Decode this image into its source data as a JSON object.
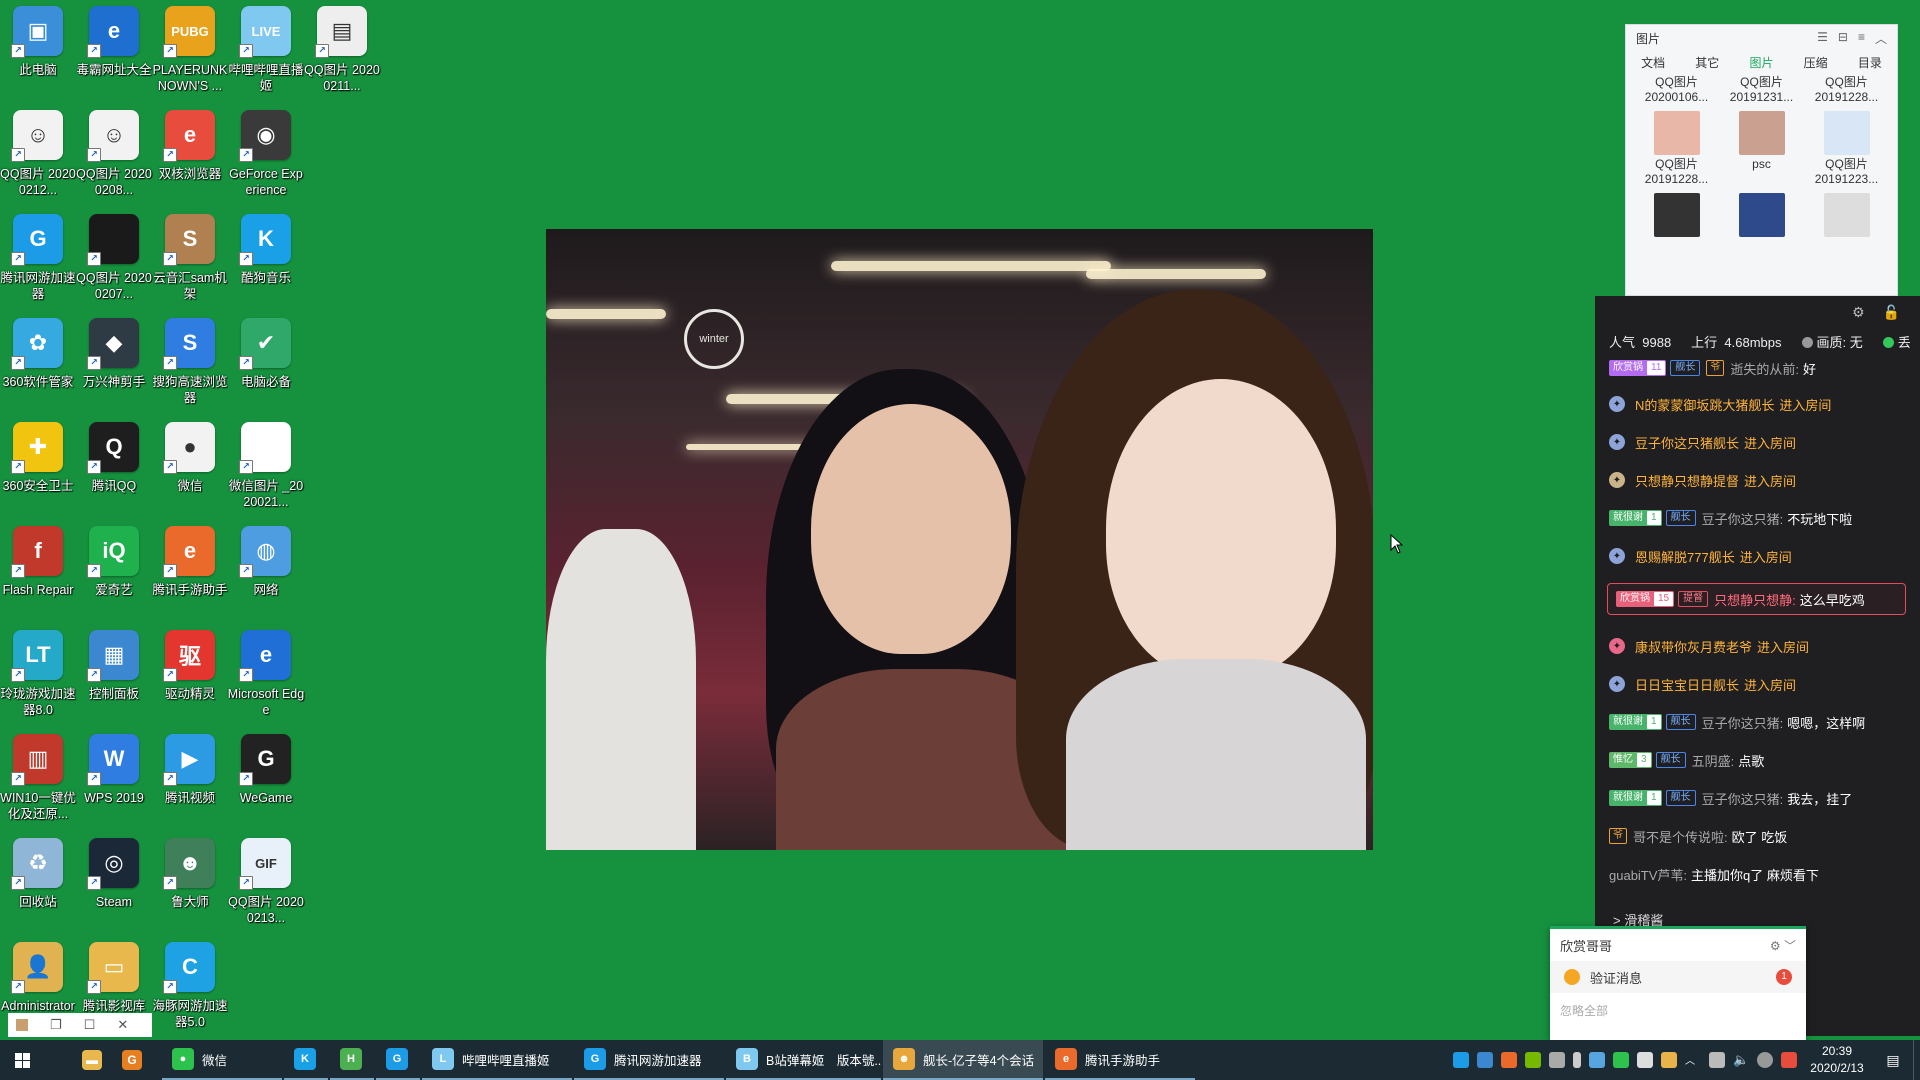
{
  "desktop": {
    "icons": [
      {
        "label": "此电脑",
        "bg": "#3a8fd8",
        "glyph": "▣",
        "icon": "computer-icon"
      },
      {
        "label": "毒霸网址大全",
        "bg": "#1e6fd0",
        "glyph": "e",
        "icon": "ie-browser-icon"
      },
      {
        "label": "PLAYERUNKNOWN'S ...",
        "bg": "#e8a21c",
        "glyph": "PUBG",
        "icon": "pubg-icon"
      },
      {
        "label": "哔哩哔哩直播姬",
        "bg": "#7fc8f0",
        "glyph": "LIVE",
        "icon": "bilibili-live-icon"
      },
      {
        "label": "QQ图片 20200211...",
        "bg": "#eeeeee",
        "glyph": "▤",
        "icon": "image-file-icon"
      },
      {
        "label": "QQ图片 20200212...",
        "bg": "#f2f2f2",
        "glyph": "☺",
        "icon": "image-file-icon"
      },
      {
        "label": "QQ图片 20200208...",
        "bg": "#f2f2f2",
        "glyph": "☺",
        "icon": "image-file-icon"
      },
      {
        "label": "双核浏览器",
        "bg": "#e84c3d",
        "glyph": "e",
        "icon": "dual-core-browser-icon"
      },
      {
        "label": "GeForce Experience",
        "bg": "#3a3a3a",
        "glyph": "◉",
        "icon": "nvidia-icon"
      },
      {
        "label": "腾讯网游加速器",
        "bg": "#1c9be6",
        "glyph": "G",
        "icon": "tencent-accelerator-icon"
      },
      {
        "label": "QQ图片 20200207...",
        "bg": "#1a1a1a",
        "glyph": "",
        "icon": "image-file-icon"
      },
      {
        "label": "云音汇sam机架",
        "bg": "#b08050",
        "glyph": "S",
        "icon": "sam-rack-icon"
      },
      {
        "label": "酷狗音乐",
        "bg": "#1aa0e6",
        "glyph": "K",
        "icon": "kugou-music-icon"
      },
      {
        "label": "360软件管家",
        "bg": "#35a9e0",
        "glyph": "✿",
        "icon": "360-software-icon"
      },
      {
        "label": "万兴神剪手",
        "bg": "#2e3b44",
        "glyph": "◆",
        "icon": "filmora-icon"
      },
      {
        "label": "搜狗高速浏览器",
        "bg": "#2f7de1",
        "glyph": "S",
        "icon": "sogou-browser-icon"
      },
      {
        "label": "电脑必备",
        "bg": "#30a86a",
        "glyph": "✔",
        "icon": "pc-essentials-icon"
      },
      {
        "label": "360安全卫士",
        "bg": "#f1c40f",
        "glyph": "✚",
        "icon": "360-security-icon"
      },
      {
        "label": "腾讯QQ",
        "bg": "#1e1e1e",
        "glyph": "Q",
        "icon": "qq-icon"
      },
      {
        "label": "微信",
        "bg": "#f2f2f2",
        "glyph": "●",
        "icon": "wechat-icon"
      },
      {
        "label": "微信图片 _2020021...",
        "bg": "#ffffff",
        "glyph": "",
        "icon": "image-file-icon"
      },
      {
        "label": "Flash Repair",
        "bg": "#c0392b",
        "glyph": "f",
        "icon": "flash-repair-icon"
      },
      {
        "label": "爱奇艺",
        "bg": "#1fb14d",
        "glyph": "iQ",
        "icon": "iqiyi-icon"
      },
      {
        "label": "腾讯手游助手",
        "bg": "#e96a2a",
        "glyph": "e",
        "icon": "tencent-mobile-game-icon"
      },
      {
        "label": "网络",
        "bg": "#4e9de0",
        "glyph": "◍",
        "icon": "network-icon"
      },
      {
        "label": "玲珑游戏加速器8.0",
        "bg": "#25a9c9",
        "glyph": "LT",
        "icon": "linglong-accelerator-icon"
      },
      {
        "label": "控制面板",
        "bg": "#3c88d0",
        "glyph": "▦",
        "icon": "control-panel-icon"
      },
      {
        "label": "驱动精灵",
        "bg": "#e2362e",
        "glyph": "驱",
        "icon": "driver-genius-icon"
      },
      {
        "label": "Microsoft Edge",
        "bg": "#1f6fd6",
        "glyph": "e",
        "icon": "edge-icon"
      },
      {
        "label": "WIN10一键优化及还原...",
        "bg": "#c0392b",
        "glyph": "▥",
        "icon": "win10-optimizer-icon"
      },
      {
        "label": "WPS 2019",
        "bg": "#2f7de1",
        "glyph": "W",
        "icon": "wps-icon"
      },
      {
        "label": "腾讯视频",
        "bg": "#2d9be4",
        "glyph": "▶",
        "icon": "tencent-video-icon"
      },
      {
        "label": "WeGame",
        "bg": "#222222",
        "glyph": "G",
        "icon": "wegame-icon"
      },
      {
        "label": "回收站",
        "bg": "#8fb6d6",
        "glyph": "♻",
        "icon": "recycle-bin-icon"
      },
      {
        "label": "Steam",
        "bg": "#1b2838",
        "glyph": "◎",
        "icon": "steam-icon"
      },
      {
        "label": "鲁大师",
        "bg": "#3f7f5a",
        "glyph": "☻",
        "icon": "ludashi-icon"
      },
      {
        "label": "QQ图片 20200213...",
        "bg": "#e8f0fa",
        "glyph": "GIF",
        "icon": "gif-file-icon"
      },
      {
        "label": "Administrator",
        "bg": "#e0b250",
        "glyph": "👤",
        "icon": "user-folder-icon"
      },
      {
        "label": "腾讯影视库",
        "bg": "#e9b84c",
        "glyph": "▭",
        "icon": "tencent-film-library-icon"
      },
      {
        "label": "海豚网游加速器5.0",
        "bg": "#1ea2e3",
        "glyph": "C",
        "icon": "dolphin-accelerator-icon"
      }
    ]
  },
  "file_panel": {
    "title": "图片",
    "tabs": [
      "文档",
      "其它",
      "图片",
      "压缩",
      "目录"
    ],
    "active_tab": 2,
    "items": [
      {
        "name": "QQ图片 20200106...",
        "thumb": "none"
      },
      {
        "name": "QQ图片 20191231...",
        "thumb": "none"
      },
      {
        "name": "QQ图片 20191228...",
        "thumb": "none"
      },
      {
        "name": "QQ图片 20191228...",
        "thumb": "#e8b7a8"
      },
      {
        "name": "psc",
        "thumb": "#caa090"
      },
      {
        "name": "QQ图片 20191223...",
        "thumb": "#d9e6f5"
      },
      {
        "name": "",
        "thumb": "#333333"
      },
      {
        "name": "",
        "thumb": "#2f4a8a"
      },
      {
        "name": "",
        "thumb": "#dddddd"
      }
    ]
  },
  "live_panel": {
    "popularity_label": "人气",
    "popularity_value": "9988",
    "upload_label": "上行",
    "upload_value": "4.68mbps",
    "video_label": "画质: 无",
    "audio_label": "丢",
    "messages": [
      {
        "type": "chat",
        "badge": "欣赏锅",
        "badge_color": "#b36cf0",
        "level": "11",
        "role": "舰长",
        "role2": "爷",
        "name": "逝失的从前:",
        "text": "好"
      },
      {
        "type": "enter",
        "icon_color": "#8ea4d8",
        "name": "N的蒙蒙御坂跳大猪舰长",
        "text": "进入房间"
      },
      {
        "type": "enter",
        "icon_color": "#8ea4d8",
        "name": "豆子你这只猪舰长",
        "text": "进入房间"
      },
      {
        "type": "enter",
        "icon_color": "#c9b48a",
        "name": "只想静只想静提督",
        "text": "进入房间"
      },
      {
        "type": "chat",
        "badge": "就很谢",
        "badge_color": "#47b36b",
        "level": "1",
        "role": "舰长",
        "name": "豆子你这只猪:",
        "text": "不玩地下啦"
      },
      {
        "type": "enter",
        "icon_color": "#8ea4d8",
        "name": "恩赐解脱777舰长",
        "text": "进入房间"
      },
      {
        "type": "highlight",
        "badge": "欣赏锅",
        "badge_color": "#e8607a",
        "level": "15",
        "role": "提督",
        "name": "只想静只想静:",
        "text": "这么早吃鸡"
      },
      {
        "type": "enter",
        "icon_color": "#e9688a",
        "name": "康叔带你灰月费老爷",
        "text": "进入房间"
      },
      {
        "type": "enter",
        "icon_color": "#8ea4d8",
        "name": "日日宝宝日日舰长",
        "text": "进入房间"
      },
      {
        "type": "chat",
        "badge": "就很谢",
        "badge_color": "#47b36b",
        "level": "1",
        "role": "舰长",
        "name": "豆子你这只猪:",
        "text": "嗯嗯，这样啊"
      },
      {
        "type": "chat",
        "badge": "惟忆",
        "badge_color": "#5fb86a",
        "level": "3",
        "role": "舰长",
        "name": "五阴盛:",
        "text": "点歌"
      },
      {
        "type": "chat",
        "badge": "就很谢",
        "badge_color": "#47b36b",
        "level": "1",
        "role": "舰长",
        "name": "豆子你这只猪:",
        "text": "我去，挂了"
      },
      {
        "type": "chat",
        "role2": "爷",
        "name": "哥不是个传说啦:",
        "text": "欧了 吃饭"
      },
      {
        "type": "chat",
        "name": "guabiTV芦苇:",
        "text": "主播加你q了 麻烦看下"
      }
    ],
    "footer_label": "> 滑稽酱"
  },
  "notification": {
    "title": "欣赏哥哥",
    "item_label": "验证消息",
    "item_count": "1",
    "ignore_all": "忽略全部"
  },
  "taskbar": {
    "pinned": [
      {
        "icon": "file-explorer-icon",
        "bg": "#e8b84c",
        "glyph": "▬"
      },
      {
        "icon": "sogou-icon",
        "bg": "#e67e22",
        "glyph": "G"
      }
    ],
    "apps": [
      {
        "label": "微信",
        "icon": "wechat-icon",
        "bg": "#2dc14d",
        "glyph": "●",
        "width": 120
      },
      {
        "label": "",
        "icon": "kugou-music-icon",
        "bg": "#1aa0e6",
        "glyph": "K",
        "width": 44
      },
      {
        "label": "",
        "icon": "h-app-icon",
        "bg": "#4caf50",
        "glyph": "H",
        "width": 44
      },
      {
        "label": "",
        "icon": "tencent-accelerator-icon",
        "bg": "#1c9be6",
        "glyph": "G",
        "width": 44
      },
      {
        "label": "哔哩哔哩直播姬",
        "icon": "bilibili-live-icon",
        "bg": "#7fc8f0",
        "glyph": "L",
        "width": 150
      },
      {
        "label": "腾讯网游加速器",
        "icon": "tencent-accelerator-icon",
        "bg": "#1c9be6",
        "glyph": "G",
        "width": 150
      },
      {
        "label": "B站弹幕姬　版本號...",
        "icon": "bilibili-danmaku-icon",
        "bg": "#7fc8f0",
        "glyph": "B",
        "width": 155
      },
      {
        "label": "舰长-亿子等4个会话",
        "icon": "chat-sessions-icon",
        "bg": "#e8a73c",
        "glyph": "☻",
        "width": 160,
        "active": true
      },
      {
        "label": "腾讯手游助手",
        "icon": "tencent-mobile-game-icon",
        "bg": "#e96a2a",
        "glyph": "e",
        "width": 150
      }
    ],
    "clock_time": "20:39",
    "clock_date": "2020/2/13"
  },
  "mini_window": {
    "restore": "❐",
    "maximize": "☐",
    "close": "✕"
  }
}
